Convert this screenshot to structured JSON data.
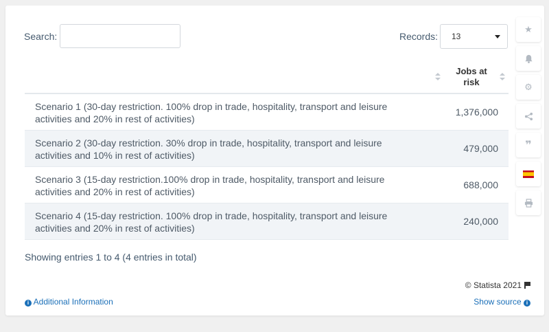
{
  "search": {
    "label": "Search:",
    "value": "",
    "placeholder": ""
  },
  "records": {
    "label": "Records:",
    "selected": "13"
  },
  "table": {
    "columns": [
      "",
      "Jobs at risk"
    ],
    "rows": [
      {
        "scenario": "Scenario 1 (30-day restriction. 100% drop in trade, hospitality, transport and leisure activities and 20% in rest of activities)",
        "jobs": "1,376,000"
      },
      {
        "scenario": "Scenario 2 (30-day restriction. 30% drop in trade, hospitality, transport and leisure activities and 10% in rest of activities)",
        "jobs": "479,000"
      },
      {
        "scenario": "Scenario 3 (15-day restriction.100% drop in trade, hospitality, transport and leisure activities and 20% in rest of activities)",
        "jobs": "688,000"
      },
      {
        "scenario": "Scenario 4 (15-day restriction. 100% drop in trade, hospitality, transport and leisure activities and 20% in rest of activities)",
        "jobs": "240,000"
      }
    ]
  },
  "footer": {
    "showing": "Showing entries 1 to 4 (4 entries in total)",
    "copyright": "© Statista 2021",
    "additional_info": "Additional Information",
    "show_source": "Show source"
  },
  "sidebar": {
    "icons": [
      "star-icon",
      "bell-icon",
      "gear-icon",
      "share-icon",
      "quote-icon",
      "spain-flag-icon",
      "print-icon"
    ]
  },
  "colors": {
    "link": "#1a6fb8",
    "row_alt": "#f1f4f7"
  }
}
